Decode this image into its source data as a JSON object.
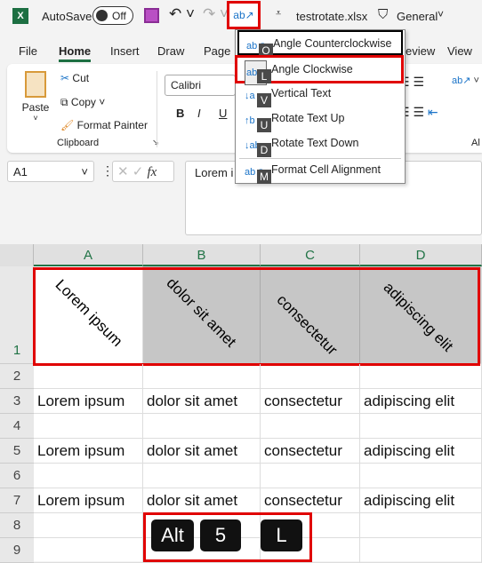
{
  "titlebar": {
    "autosave": "AutoSave",
    "toggle": "Off",
    "filename": "testrotate.xlsx",
    "sensitivity": "General"
  },
  "tabs": [
    "File",
    "Home",
    "Insert",
    "Draw",
    "Page L",
    "eview",
    "View"
  ],
  "ribbon": {
    "paste": "Paste",
    "cut": "Cut",
    "copy": "Copy",
    "format_painter": "Format Painter",
    "clipboard": "Clipboard",
    "font": "Calibri",
    "bold": "B",
    "italic": "I",
    "underline": "U",
    "alignment_partial": "Al"
  },
  "formula_bar": {
    "name_box": "A1",
    "fx": "fx",
    "content": "Lorem i"
  },
  "menu": {
    "items": [
      {
        "label": "Angle Counterclockwise",
        "key": "O",
        "icon": "angle-counterclockwise-icon"
      },
      {
        "label": "Angle Clockwise",
        "key": "L",
        "icon": "angle-clockwise-icon"
      },
      {
        "label": "Vertical Text",
        "key": "V",
        "icon": "vertical-text-icon"
      },
      {
        "label": "Rotate Text Up",
        "key": "U",
        "icon": "rotate-up-icon"
      },
      {
        "label": "Rotate Text Down",
        "key": "D",
        "icon": "rotate-down-icon"
      },
      {
        "label": "Format Cell Alignment",
        "key": "M",
        "icon": "format-alignment-icon"
      }
    ]
  },
  "sheet": {
    "columns": [
      "A",
      "B",
      "C",
      "D"
    ],
    "rows": [
      "1",
      "2",
      "3",
      "4",
      "5",
      "6",
      "7",
      "8",
      "9"
    ],
    "header_row": [
      "Lorem ipsum",
      "dolor sit amet",
      "consectetur",
      "adipiscing elit"
    ],
    "data_row": [
      "Lorem ipsum",
      "dolor sit amet",
      "consectetur",
      "adipiscing elit"
    ],
    "header_fill": "#c6c6c6"
  },
  "keys": [
    "Alt",
    "5",
    "L"
  ],
  "colors": {
    "highlight": "#e00000",
    "excel_green": "#217346"
  }
}
